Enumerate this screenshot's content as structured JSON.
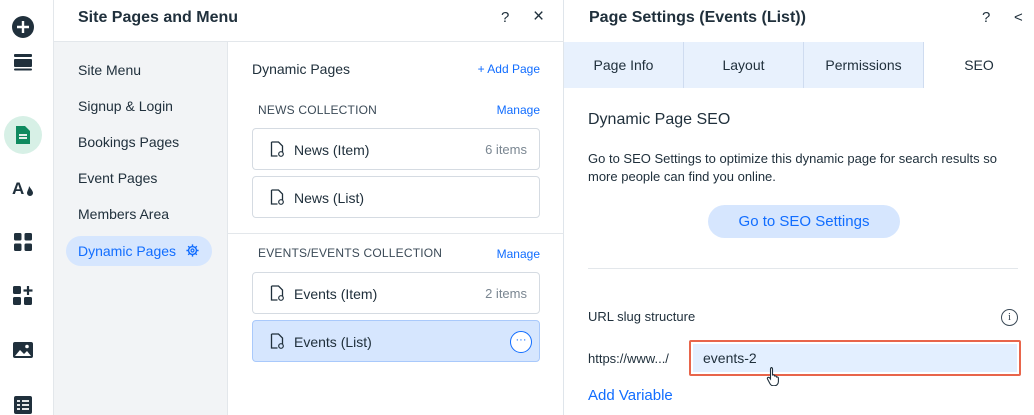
{
  "rail": {
    "icons": [
      "add-icon",
      "layers-icon",
      "pages-icon",
      "design-icon",
      "apps-icon",
      "add-apps-icon",
      "media-icon",
      "cms-icon"
    ],
    "active": "pages-icon"
  },
  "site_pages": {
    "title": "Site Pages and Menu",
    "help": "?",
    "close": "×",
    "nav": [
      "Site Menu",
      "Signup & Login",
      "Bookings Pages",
      "Event Pages",
      "Members Area"
    ],
    "nav_active": "Dynamic Pages",
    "content_title": "Dynamic Pages",
    "add_page": "+ Add Page",
    "sections": [
      {
        "header": "NEWS COLLECTION",
        "manage": "Manage",
        "pages": [
          {
            "name": "News (Item)",
            "count": "6 items"
          },
          {
            "name": "News (List)",
            "count": ""
          }
        ]
      },
      {
        "header": "EVENTS/EVENTS COLLECTION",
        "manage": "Manage",
        "pages": [
          {
            "name": "Events (Item)",
            "count": "2 items"
          },
          {
            "name": "Events (List)",
            "count": "",
            "more": "···"
          }
        ]
      }
    ]
  },
  "page_settings": {
    "title": "Page Settings (Events (List))",
    "help": "?",
    "back": "<",
    "tabs": [
      "Page Info",
      "Layout",
      "Permissions",
      "SEO"
    ],
    "active_tab": "SEO",
    "heading": "Dynamic Page SEO",
    "description": "Go to SEO Settings to optimize this dynamic page for search results so more people can find you online.",
    "seo_button": "Go to SEO Settings",
    "slug_label": "URL slug structure",
    "info": "i",
    "url_prefix": "https://www.../",
    "slug_value": "events-2",
    "add_variable": "Add Variable"
  },
  "colors": {
    "accent": "#116dff",
    "highlight": "#e8654b",
    "active_bg": "#d6e6fe",
    "rail_active": "#d7f0e6"
  }
}
